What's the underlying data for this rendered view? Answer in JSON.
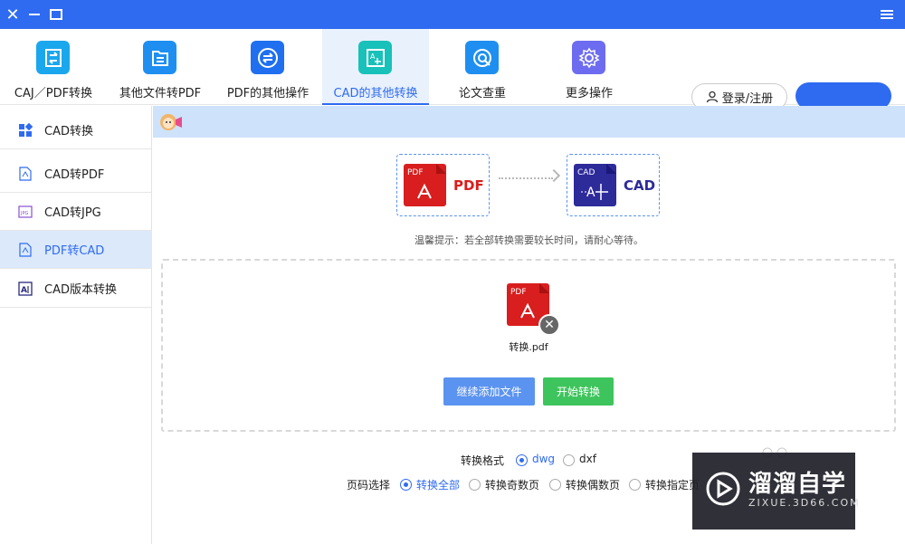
{
  "titlebar": {
    "close_icon": "close-icon",
    "minimize_icon": "minimize-icon",
    "maximize_icon": "maximize-icon",
    "menu_icon": "hamburger-menu-icon",
    "color": "#2f6bf0"
  },
  "nav": {
    "items": [
      {
        "label": "CAJ／PDF转换",
        "icon": "caj-pdf-convert-icon",
        "color": "#1aa7ee"
      },
      {
        "label": "其他文件转PDF",
        "icon": "file-to-pdf-icon",
        "color": "#1e8ff0"
      },
      {
        "label": "PDF的其他操作",
        "icon": "pdf-ops-icon",
        "color": "#1f6ff0"
      },
      {
        "label": "CAD的其他转换",
        "icon": "cad-convert-icon",
        "color": "#18c1b9",
        "active": true
      },
      {
        "label": "论文查重",
        "icon": "paper-check-icon",
        "color": "#1e8ff0"
      },
      {
        "label": "更多操作",
        "icon": "more-settings-icon",
        "color": "#6d6cf0"
      }
    ],
    "login_label": "登录/注册"
  },
  "sidebar": {
    "items": [
      {
        "label": "CAD转换",
        "icon": "grid-icon"
      },
      {
        "label": "CAD转PDF",
        "icon": "pdf-file-icon"
      },
      {
        "label": "CAD转JPG",
        "icon": "jpg-file-icon"
      },
      {
        "label": "PDF转CAD",
        "icon": "pdf-file-icon",
        "active": true
      },
      {
        "label": "CAD版本转换",
        "icon": "cad-version-icon"
      }
    ]
  },
  "conversion": {
    "from_label": "PDF",
    "to_label": "CAD",
    "from_badge": "PDF",
    "to_badge": "CAD",
    "tip": "温馨提示：若全部转换需要较长时间，请耐心等待。"
  },
  "file": {
    "badge": "PDF",
    "name": "转换.pdf"
  },
  "buttons": {
    "add_more": "继续添加文件",
    "start": "开始转换"
  },
  "options": {
    "format_label": "转换格式",
    "formats": [
      {
        "label": "dwg",
        "checked": true
      },
      {
        "label": "dxf",
        "checked": false
      }
    ],
    "page_label": "页码选择",
    "pages": [
      {
        "label": "转换全部",
        "checked": true
      },
      {
        "label": "转换奇数页",
        "checked": false
      },
      {
        "label": "转换偶数页",
        "checked": false
      },
      {
        "label": "转换指定页",
        "checked": false
      }
    ]
  },
  "watermark": {
    "title": "溜溜自学",
    "sub": "ZIXUE.3D66.COM"
  }
}
